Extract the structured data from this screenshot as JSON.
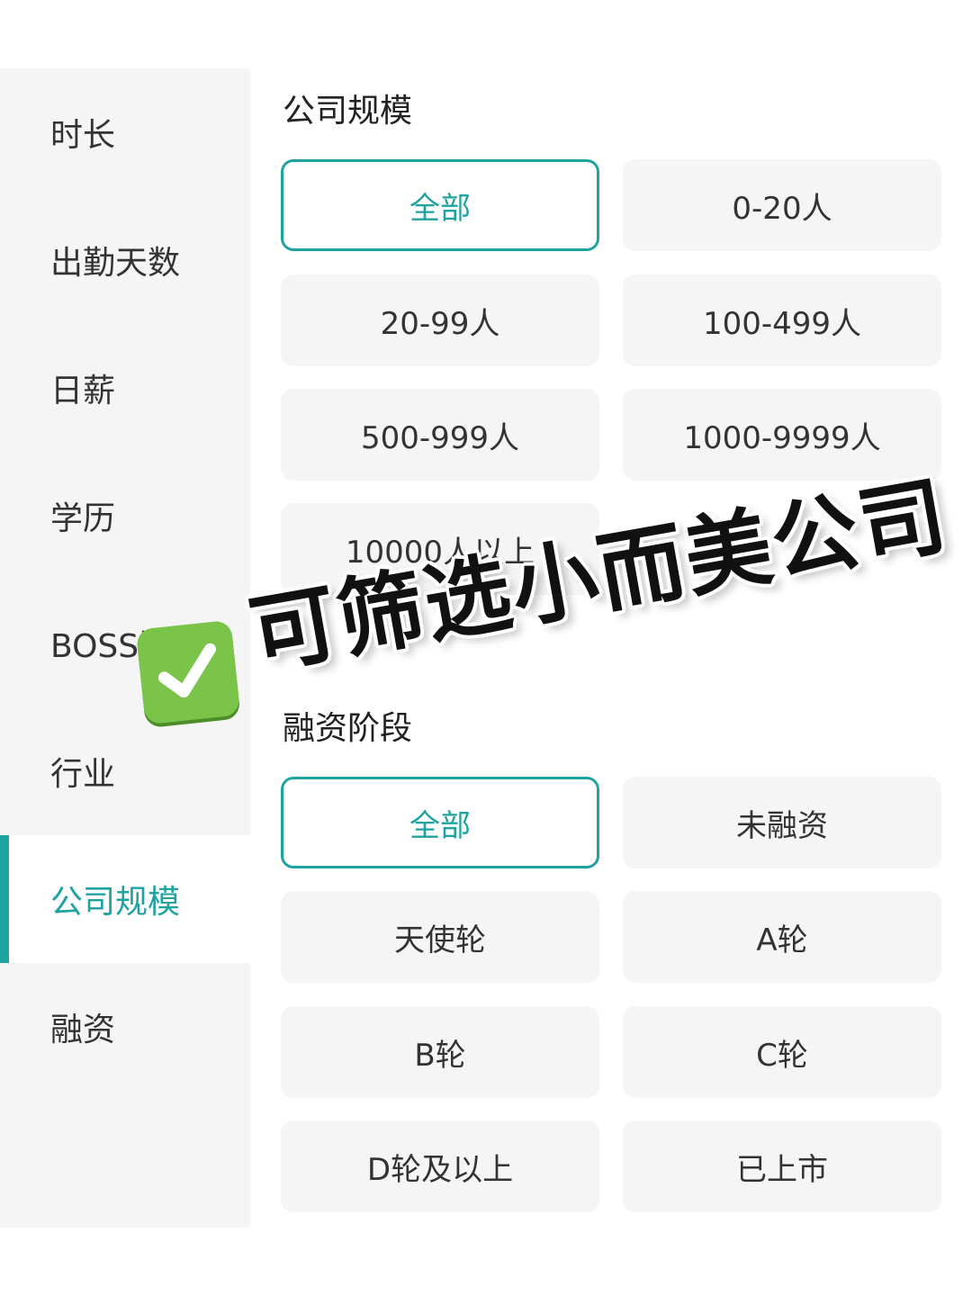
{
  "sidebar": {
    "items": [
      {
        "label": "时长"
      },
      {
        "label": "出勤天数"
      },
      {
        "label": "日薪"
      },
      {
        "label": "学历"
      },
      {
        "label": "BOSS活跃"
      },
      {
        "label": "行业"
      },
      {
        "label": "公司规模",
        "active": true
      },
      {
        "label": "融资"
      }
    ]
  },
  "company_size": {
    "title": "公司规模",
    "options": [
      "全部",
      "0-20人",
      "20-99人",
      "100-499人",
      "500-999人",
      "1000-9999人",
      "10000人以上"
    ],
    "selected": "全部"
  },
  "funding": {
    "title": "融资阶段",
    "options": [
      "全部",
      "未融资",
      "天使轮",
      "A轮",
      "B轮",
      "C轮",
      "D轮及以上",
      "已上市"
    ],
    "selected": "全部"
  },
  "overlay": {
    "text": "可筛选小而美公司",
    "icon": "check-mark-icon"
  },
  "colors": {
    "accent": "#1fa3a0",
    "option_bg": "#f5f5f5",
    "sidebar_bg": "#f5f5f5",
    "check_green": "#7bc44a"
  }
}
